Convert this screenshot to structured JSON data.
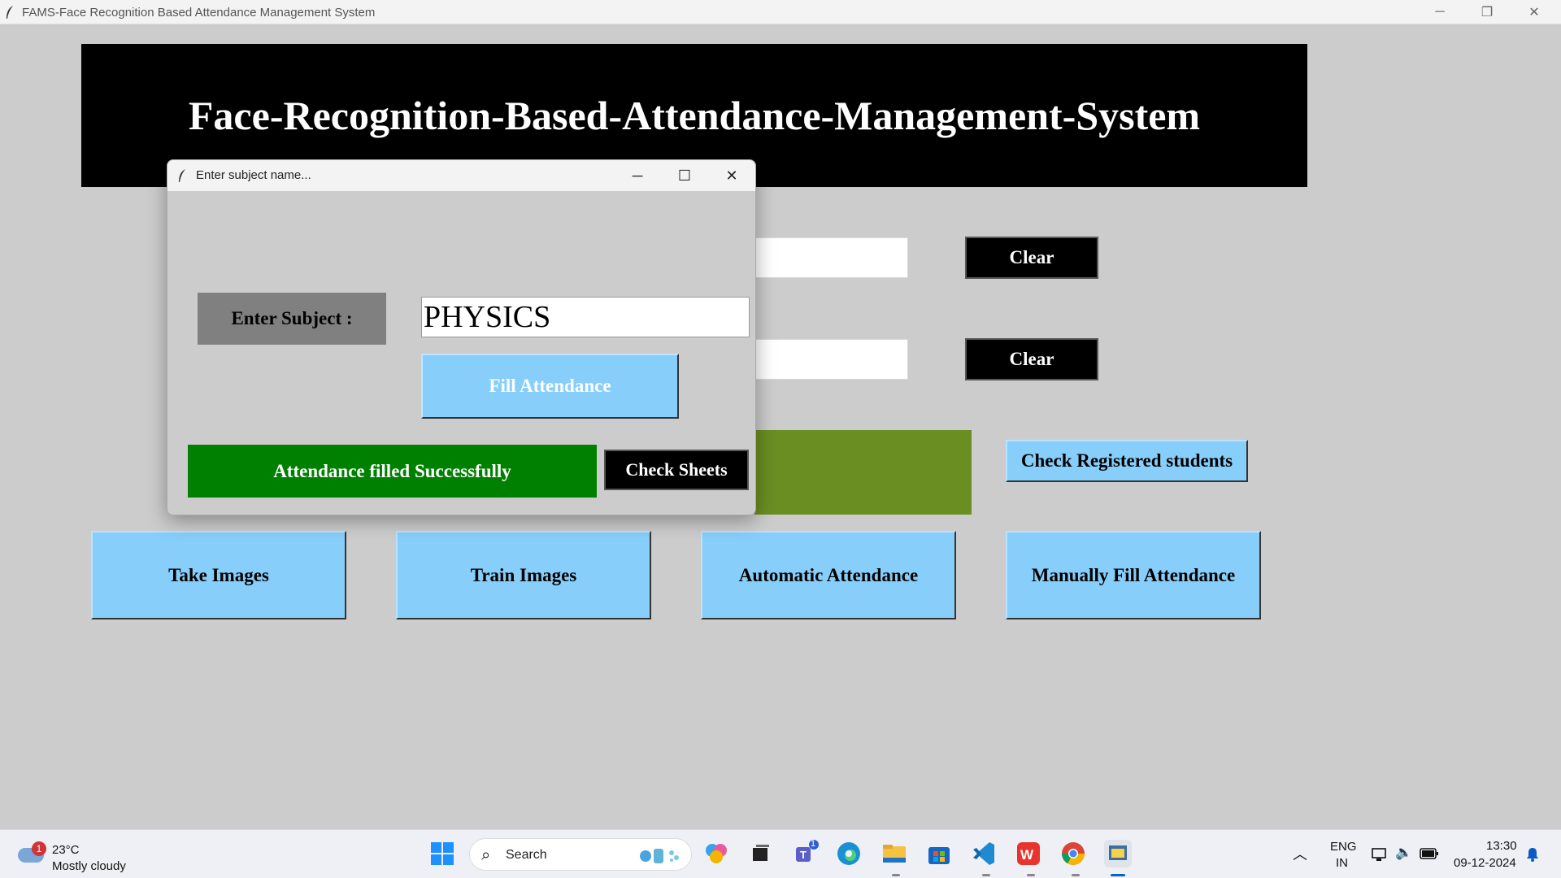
{
  "window": {
    "title": "FAMS-Face Recognition Based Attendance Management System",
    "minimize": "─",
    "restore": "❐",
    "close": "✕"
  },
  "main": {
    "banner_title": "Face-Recognition-Based-Attendance-Management-System",
    "clear1": "Clear",
    "clear2": "Clear",
    "check_registered": "Check Registered students",
    "take_images": "Take Images",
    "train_images": "Train Images",
    "automatic_attendance": "Automatic Attendance",
    "manual_attendance": "Manually Fill Attendance"
  },
  "dialog": {
    "title": "Enter subject name...",
    "minimize": "─",
    "maximize": "☐",
    "close": "✕",
    "subject_label": "Enter Subject :",
    "subject_value": "PHYSICS",
    "fill_attendance": "Fill Attendance",
    "status": "Attendance filled Successfully",
    "check_sheets": "Check Sheets"
  },
  "taskbar": {
    "weather_badge": "1",
    "temperature": "23°C",
    "condition": "Mostly cloudy",
    "search_label": "Search",
    "teams_badge": "1",
    "lang_top": "ENG",
    "lang_bottom": "IN",
    "time": "13:30",
    "date": "09-12-2024"
  },
  "colors": {
    "background": "#cccccc",
    "banner": "#000000",
    "button_blue": "#87cefa",
    "success_green": "#008000",
    "olive": "#6b8e23"
  }
}
